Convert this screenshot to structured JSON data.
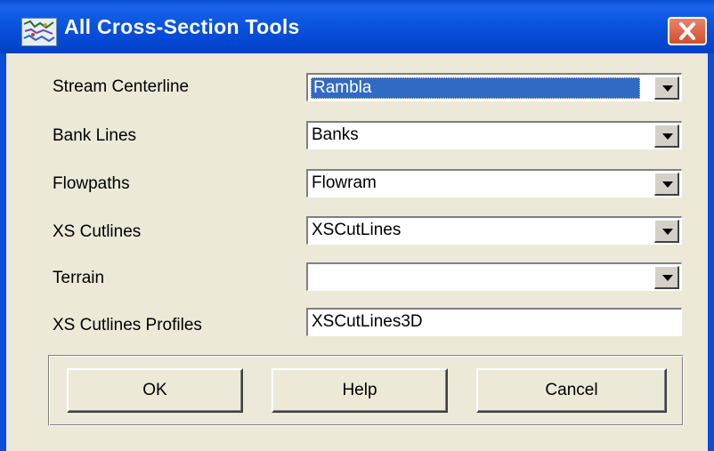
{
  "window": {
    "title": "All Cross-Section Tools",
    "close_label": "×"
  },
  "fields": {
    "stream_centerline": {
      "label": "Stream Centerline",
      "value": "Rambla",
      "selected": true
    },
    "bank_lines": {
      "label": "Bank Lines",
      "value": "Banks"
    },
    "flowpaths": {
      "label": "Flowpaths",
      "value": "Flowram"
    },
    "xs_cutlines": {
      "label": "XS Cutlines",
      "value": "XSCutLines"
    },
    "terrain": {
      "label": "Terrain",
      "value": ""
    },
    "xs_cutlines_profiles": {
      "label": "XS Cutlines Profiles",
      "value": "XSCutLines3D"
    }
  },
  "buttons": {
    "ok": "OK",
    "help": "Help",
    "cancel": "Cancel"
  },
  "colors": {
    "titlebar": "#0a55e0",
    "dialog_face": "#ece9d8",
    "selection": "#316ac5",
    "close_button": "#d24f2f"
  }
}
